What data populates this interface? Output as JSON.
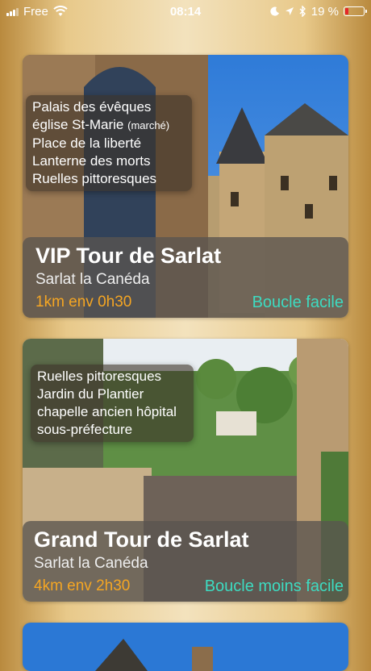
{
  "status_bar": {
    "carrier": "Free",
    "time": "08:14",
    "battery_text": "19 %",
    "battery_level": 0.19,
    "icons": [
      "signal-icon",
      "wifi-icon",
      "moon-icon",
      "location-arrow-icon",
      "bluetooth-icon",
      "battery-icon"
    ]
  },
  "tours": [
    {
      "stops": [
        "Palais des évêques",
        "église St-Marie",
        "Place de la liberté",
        "Lanterne des morts",
        "Ruelles pittoresques"
      ],
      "stop2_note": "(marché)",
      "title": "VIP Tour de Sarlat",
      "subtitle": "Sarlat la Canéda",
      "distance": "1km env 0h30",
      "type": "Boucle facile"
    },
    {
      "stops": [
        "Ruelles pittoresques",
        "Jardin du Plantier",
        "chapelle ancien hôpital",
        "sous-préfecture"
      ],
      "title": "Grand Tour de Sarlat",
      "subtitle": "Sarlat la Canéda",
      "distance": "4km env 2h30",
      "type": "Boucle moins facile"
    }
  ],
  "colors": {
    "distance": "#f5a623",
    "loop_type": "#3ddbc1",
    "battery": "#e5262a"
  }
}
